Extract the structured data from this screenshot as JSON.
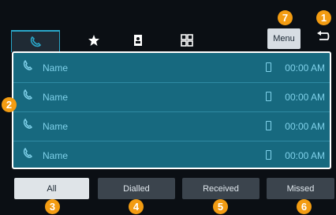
{
  "header": {
    "menu_label": "Menu"
  },
  "tabs": [
    {
      "name": "recent-calls",
      "icon": "phone-icon",
      "active": true
    },
    {
      "name": "favorites",
      "icon": "star-icon",
      "active": false
    },
    {
      "name": "contacts",
      "icon": "contacts-icon",
      "active": false
    },
    {
      "name": "keypad",
      "icon": "keypad-icon",
      "active": false
    }
  ],
  "call_list": [
    {
      "name": "Name",
      "time": "00:00 AM"
    },
    {
      "name": "Name",
      "time": "00:00 AM"
    },
    {
      "name": "Name",
      "time": "00:00 AM"
    },
    {
      "name": "Name",
      "time": "00:00 AM"
    }
  ],
  "filters": [
    {
      "label": "All",
      "active": true
    },
    {
      "label": "Dialled",
      "active": false
    },
    {
      "label": "Received",
      "active": false
    },
    {
      "label": "Missed",
      "active": false
    }
  ],
  "callouts": {
    "c1": "1",
    "c2": "2",
    "c3": "3",
    "c4": "4",
    "c5": "5",
    "c6": "6",
    "c7": "7"
  },
  "colors": {
    "accent": "#f39c12",
    "list_bg": "#17697f",
    "screen_bg": "#0b0f14"
  }
}
